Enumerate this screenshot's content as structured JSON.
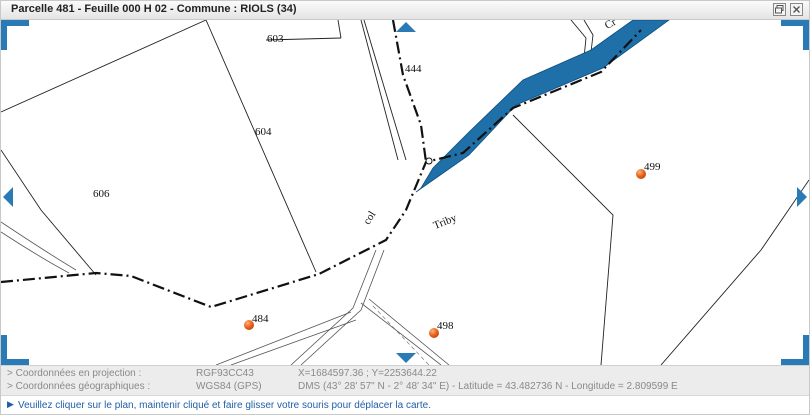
{
  "window": {
    "title": "Parcelle 481 - Feuille 000 H 02 - Commune : RIOLS (34)",
    "buttons": [
      {
        "name": "restore-icon"
      },
      {
        "name": "close-icon"
      }
    ]
  },
  "map": {
    "parcel_labels": [
      "603",
      "444",
      "604",
      "606",
      "499",
      "484",
      "498"
    ],
    "place_labels": [
      "col",
      "Triby",
      "Cr"
    ],
    "markers": [
      "499",
      "484",
      "498"
    ],
    "colors": {
      "river": "#1f6fa8",
      "control": "#2a7ab5",
      "marker": "#e8641c"
    }
  },
  "info": {
    "projection_label": "> Coordonnées en projection :",
    "projection_system": "RGF93CC43",
    "projection_value": "X=1684597.36 ; Y=2253644.22",
    "geo_label": "> Coordonnées géographiques :",
    "geo_system": "WGS84 (GPS)",
    "geo_value": "DMS (43° 28' 57\" N - 2° 48' 34\" E) - Latitude = 43.482736 N - Longitude = 2.809599 E"
  },
  "hint": {
    "text": "Veuillez cliquer sur le plan, maintenir cliqué et faire glisser votre souris pour déplacer la carte.",
    "arrow": "▶"
  }
}
